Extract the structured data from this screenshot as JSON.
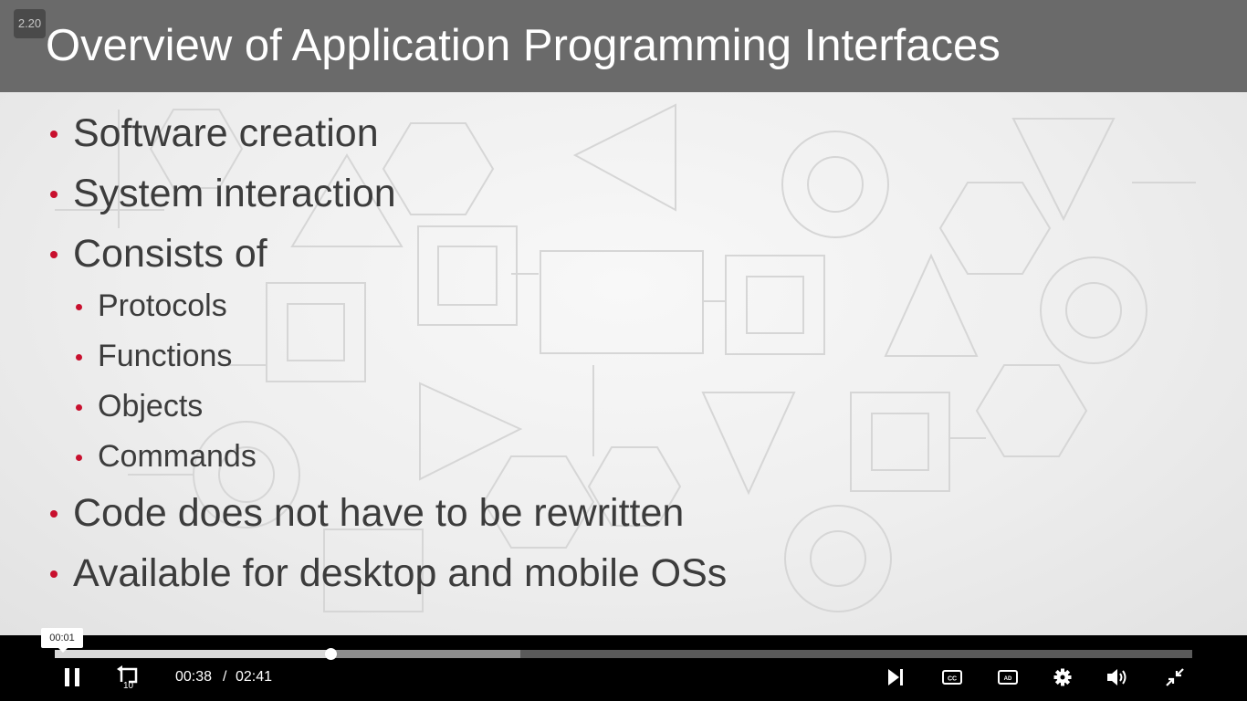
{
  "slide": {
    "chapter_badge": "2.20",
    "title": "Overview of Application Programming Interfaces",
    "bullets": [
      {
        "text": "Software creation",
        "level": 1
      },
      {
        "text": "System interaction",
        "level": 1
      },
      {
        "text": "Consists of",
        "level": 1
      },
      {
        "text": "Protocols",
        "level": 2
      },
      {
        "text": "Functions",
        "level": 2
      },
      {
        "text": "Objects",
        "level": 2
      },
      {
        "text": "Commands",
        "level": 2
      },
      {
        "text": "Code does not have to be rewritten",
        "level": 1
      },
      {
        "text": "Available for desktop and mobile OSs",
        "level": 1
      }
    ],
    "colors": {
      "title_bar": "#6a6a6a",
      "bullet_dot": "#c8102e",
      "text": "#3c3c3c"
    }
  },
  "player": {
    "hover_time": "00:01",
    "current_time": "00:38",
    "separator": "/",
    "duration": "02:41",
    "progress_fraction": 0.242,
    "buffered_fraction": 0.409,
    "controls": [
      {
        "name": "pause-button",
        "icon": "pause-icon"
      },
      {
        "name": "rewind-10-button",
        "icon": "rewind-10-icon",
        "label": "10"
      },
      {
        "name": "next-button",
        "icon": "skip-next-icon"
      },
      {
        "name": "captions-button",
        "icon": "cc-icon",
        "label": "CC"
      },
      {
        "name": "audio-description-button",
        "icon": "ad-icon",
        "label": "AD"
      },
      {
        "name": "settings-button",
        "icon": "gear-icon"
      },
      {
        "name": "volume-button",
        "icon": "volume-icon"
      },
      {
        "name": "exit-fullscreen-button",
        "icon": "exit-fullscreen-icon"
      }
    ]
  }
}
